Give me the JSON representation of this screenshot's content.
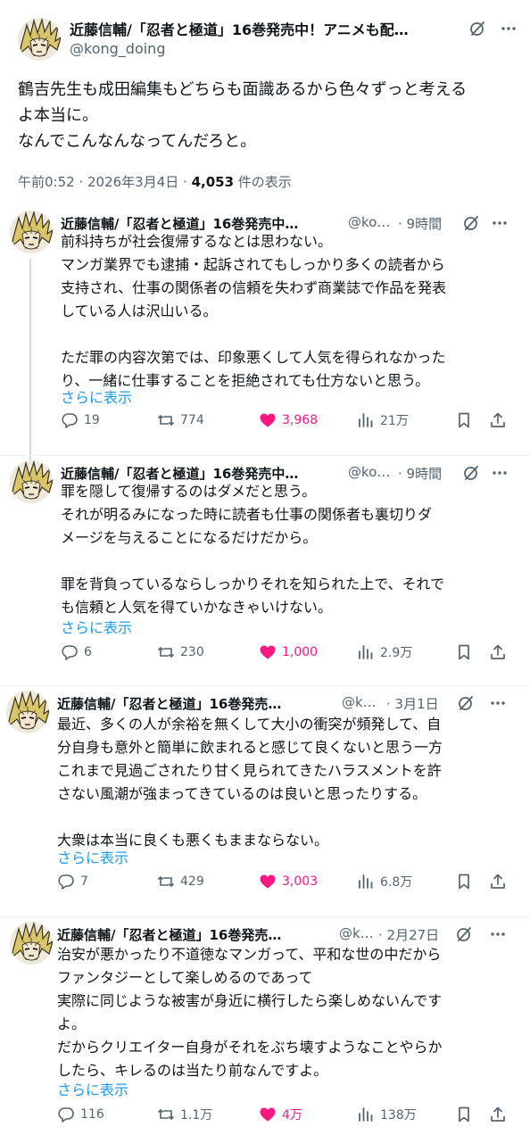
{
  "main": {
    "display_name": "近藤信輔/「忍者と極道」16巻発売中！アニメも配…",
    "handle": "@kong_doing",
    "text": "鶴吉先生も成田編集もどちらも面識あるから色々ずっと考える\nよ本当に。\nなんでこんなんなってんだろと。",
    "time": "午前0:52 · 2026年3月4日 · ",
    "views_count": "4,053",
    "views_label": " 件の表示"
  },
  "replies": [
    {
      "display_name": "近藤信輔/「忍者と極道」16巻発売中…",
      "handle": "@ko…",
      "time": "· 9時間",
      "text": "前科持ちが社会復帰するなとは思わない。\nマンガ業界でも逮捕・起訴されてもしっかり多くの読者から\n支持され、仕事の関係者の信頼を失わず商業誌で作品を発表\nしている人は沢山いる。\n\nただ罪の内容次第では、印象悪くして人気を得られなかった\nり、一緒に仕事することを拒絶されても仕方ないと思う。",
      "show_more": "さらに表示",
      "replies": "19",
      "reposts": "774",
      "likes": "3,968",
      "views": "21万"
    },
    {
      "display_name": "近藤信輔/「忍者と極道」16巻発売中…",
      "handle": "@ko…",
      "time": "· 9時間",
      "text": "罪を隠して復帰するのはダメだと思う。\nそれが明るみになった時に読者も仕事の関係者も裏切りダ\nメージを与えることになるだけだから。\n\n罪を背負っているならしっかりそれを知られた上で、それで\nも信頼と人気を得ていかなきゃいけない。",
      "show_more": "さらに表示",
      "replies": "6",
      "reposts": "230",
      "likes": "1,000",
      "views": "2.9万"
    },
    {
      "display_name": "近藤信輔/「忍者と極道」16巻発売…",
      "handle": "@k…",
      "time": "· 3月1日",
      "text": "最近、多くの人が余裕を無くして大小の衝突が頻発して、自\n分自身も意外と簡単に飲まれると感じて良くないと思う一方\nこれまで見過ごされたり甘く見られてきたハラスメントを許\nさない風潮が強まってきているのは良いと思ったりする。\n\n大衆は本当に良くも悪くもままならない。",
      "show_more": "さらに表示",
      "replies": "7",
      "reposts": "429",
      "likes": "3,003",
      "views": "6.8万"
    },
    {
      "display_name": "近藤信輔/「忍者と極道」16巻発売…",
      "handle": "@k…",
      "time": "· 2月27日",
      "text": "治安が悪かったり不道徳なマンガって、平和な世の中だから\nファンタジーとして楽しめるのであって\n実際に同じような被害が身近に横行したら楽しめないんです\nよ。\nだからクリエイター自身がそれをぶち壊すようなことやらか\nしたら、キレるのは当たり前なんですよ。",
      "show_more": "さらに表示",
      "replies": "116",
      "reposts": "1.1万",
      "likes": "4万",
      "views": "138万"
    }
  ],
  "icons": {
    "grok": "grok-icon",
    "more": "more-icon",
    "reply": "reply-icon",
    "repost": "repost-icon",
    "like": "heart-icon",
    "views": "views-icon",
    "bookmark": "bookmark-icon",
    "share": "share-icon"
  },
  "colors": {
    "text": "#0f1419",
    "secondary": "#536471",
    "link": "#1d9bf0",
    "like": "#f91880"
  }
}
